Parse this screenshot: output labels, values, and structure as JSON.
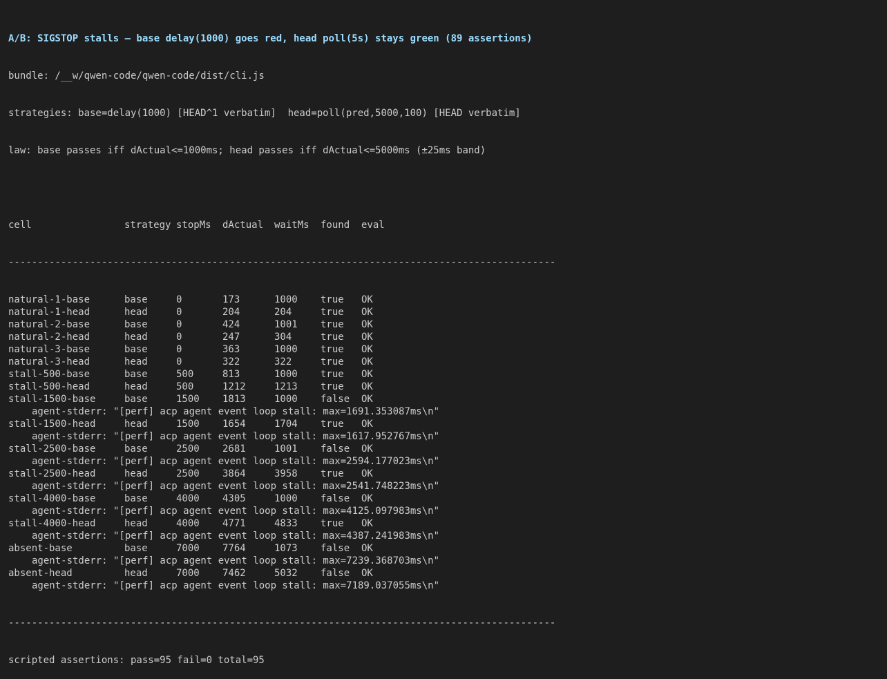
{
  "header": {
    "title": "A/B: SIGSTOP stalls — base delay(1000) goes red, head poll(5s) stays green (89 assertions)",
    "bundle": "bundle: /__w/qwen-code/qwen-code/dist/cli.js",
    "strategies": "strategies: base=delay(1000) [HEAD^1 verbatim]  head=poll(pred,5000,100) [HEAD verbatim]",
    "law": "law: base passes iff dActual<=1000ms; head passes iff dActual<=5000ms (±25ms band)"
  },
  "table": {
    "columns": [
      "cell",
      "strategy",
      "stopMs",
      "dActual",
      "waitMs",
      "found",
      "eval"
    ],
    "rule": "----------------------------------------------------------------------------------------------",
    "rows": [
      {
        "cell": "natural-1-base",
        "strategy": "base",
        "stopMs": "0",
        "dActual": "173",
        "waitMs": "1000",
        "found": "true",
        "eval": "OK",
        "stderr": ""
      },
      {
        "cell": "natural-1-head",
        "strategy": "head",
        "stopMs": "0",
        "dActual": "204",
        "waitMs": "204",
        "found": "true",
        "eval": "OK",
        "stderr": ""
      },
      {
        "cell": "natural-2-base",
        "strategy": "base",
        "stopMs": "0",
        "dActual": "424",
        "waitMs": "1001",
        "found": "true",
        "eval": "OK",
        "stderr": ""
      },
      {
        "cell": "natural-2-head",
        "strategy": "head",
        "stopMs": "0",
        "dActual": "247",
        "waitMs": "304",
        "found": "true",
        "eval": "OK",
        "stderr": ""
      },
      {
        "cell": "natural-3-base",
        "strategy": "base",
        "stopMs": "0",
        "dActual": "363",
        "waitMs": "1000",
        "found": "true",
        "eval": "OK",
        "stderr": ""
      },
      {
        "cell": "natural-3-head",
        "strategy": "head",
        "stopMs": "0",
        "dActual": "322",
        "waitMs": "322",
        "found": "true",
        "eval": "OK",
        "stderr": ""
      },
      {
        "cell": "stall-500-base",
        "strategy": "base",
        "stopMs": "500",
        "dActual": "813",
        "waitMs": "1000",
        "found": "true",
        "eval": "OK",
        "stderr": ""
      },
      {
        "cell": "stall-500-head",
        "strategy": "head",
        "stopMs": "500",
        "dActual": "1212",
        "waitMs": "1213",
        "found": "true",
        "eval": "OK",
        "stderr": ""
      },
      {
        "cell": "stall-1500-base",
        "strategy": "base",
        "stopMs": "1500",
        "dActual": "1813",
        "waitMs": "1000",
        "found": "false",
        "eval": "OK",
        "stderr": "agent-stderr: \"[perf] acp agent event loop stall: max=1691.353087ms\\n\""
      },
      {
        "cell": "stall-1500-head",
        "strategy": "head",
        "stopMs": "1500",
        "dActual": "1654",
        "waitMs": "1704",
        "found": "true",
        "eval": "OK",
        "stderr": "agent-stderr: \"[perf] acp agent event loop stall: max=1617.952767ms\\n\""
      },
      {
        "cell": "stall-2500-base",
        "strategy": "base",
        "stopMs": "2500",
        "dActual": "2681",
        "waitMs": "1001",
        "found": "false",
        "eval": "OK",
        "stderr": "agent-stderr: \"[perf] acp agent event loop stall: max=2594.177023ms\\n\""
      },
      {
        "cell": "stall-2500-head",
        "strategy": "head",
        "stopMs": "2500",
        "dActual": "3864",
        "waitMs": "3958",
        "found": "true",
        "eval": "OK",
        "stderr": "agent-stderr: \"[perf] acp agent event loop stall: max=2541.748223ms\\n\""
      },
      {
        "cell": "stall-4000-base",
        "strategy": "base",
        "stopMs": "4000",
        "dActual": "4305",
        "waitMs": "1000",
        "found": "false",
        "eval": "OK",
        "stderr": "agent-stderr: \"[perf] acp agent event loop stall: max=4125.097983ms\\n\""
      },
      {
        "cell": "stall-4000-head",
        "strategy": "head",
        "stopMs": "4000",
        "dActual": "4771",
        "waitMs": "4833",
        "found": "true",
        "eval": "OK",
        "stderr": "agent-stderr: \"[perf] acp agent event loop stall: max=4387.241983ms\\n\""
      },
      {
        "cell": "absent-base",
        "strategy": "base",
        "stopMs": "7000",
        "dActual": "7764",
        "waitMs": "1073",
        "found": "false",
        "eval": "OK",
        "stderr": "agent-stderr: \"[perf] acp agent event loop stall: max=7239.368703ms\\n\""
      },
      {
        "cell": "absent-head",
        "strategy": "head",
        "stopMs": "7000",
        "dActual": "7462",
        "waitMs": "5032",
        "found": "false",
        "eval": "OK",
        "stderr": "agent-stderr: \"[perf] acp agent event loop stall: max=7189.037055ms\\n\""
      }
    ]
  },
  "footer": {
    "summary": "scripted assertions: pass=95 fail=0 total=95"
  },
  "colors": {
    "background": "#1e1e1e",
    "text": "#cccccc",
    "title": "#9cdcfe"
  }
}
